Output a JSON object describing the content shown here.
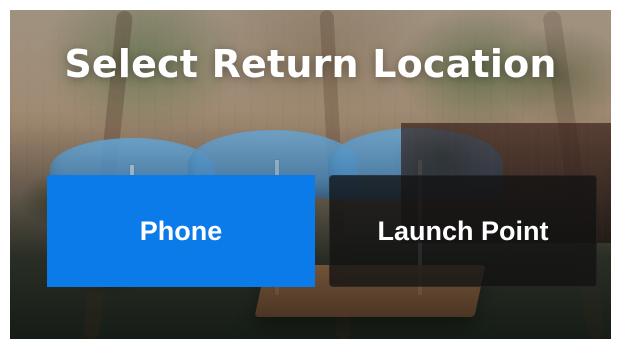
{
  "screen": {
    "title": "Select Return Location",
    "options": [
      {
        "label": "Phone",
        "style": "selected",
        "color": "#0a7be8"
      },
      {
        "label": "Launch Point",
        "style": "default",
        "color": "#121212"
      }
    ]
  }
}
